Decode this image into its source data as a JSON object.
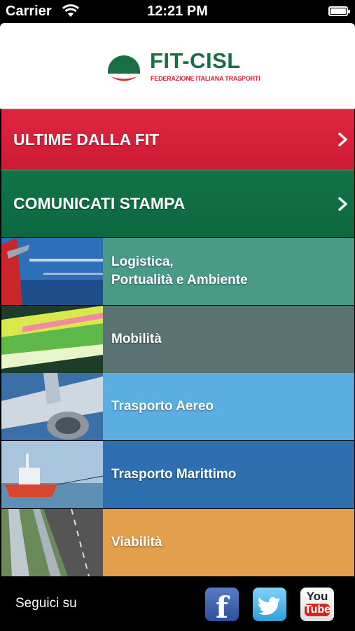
{
  "status_bar": {
    "carrier": "Carrier",
    "time": "12:21 PM"
  },
  "header": {
    "logo_title": "FIT-CISL",
    "logo_subtitle": "FEDERAZIONE ITALIANA TRASPORTI"
  },
  "menu": {
    "items": [
      {
        "label": "ULTIME DALLA FIT",
        "color": "#d71f38"
      },
      {
        "label": "COMUNICATI STAMPA",
        "color": "#0f6e44"
      }
    ]
  },
  "categories": [
    {
      "label": "Logistica,\nPortualità e Ambiente",
      "color": "#4a9a88",
      "icon": "logistics-photo"
    },
    {
      "label": "Mobilità",
      "color": "#5a7272",
      "icon": "train-motion-photo"
    },
    {
      "label": "Trasporto Aereo",
      "color": "#5aaee0",
      "icon": "airplane-photo"
    },
    {
      "label": "Trasporto Marittimo",
      "color": "#2e6fb0",
      "icon": "ship-photo"
    },
    {
      "label": "Viabilità",
      "color": "#e39f4b",
      "icon": "highway-photo"
    }
  ],
  "footer": {
    "follow_label": "Seguici su",
    "social": [
      {
        "name": "facebook",
        "glyph": "f"
      },
      {
        "name": "twitter",
        "glyph": ""
      },
      {
        "name": "youtube",
        "glyph_top": "You",
        "glyph_bottom": "Tube"
      }
    ]
  }
}
